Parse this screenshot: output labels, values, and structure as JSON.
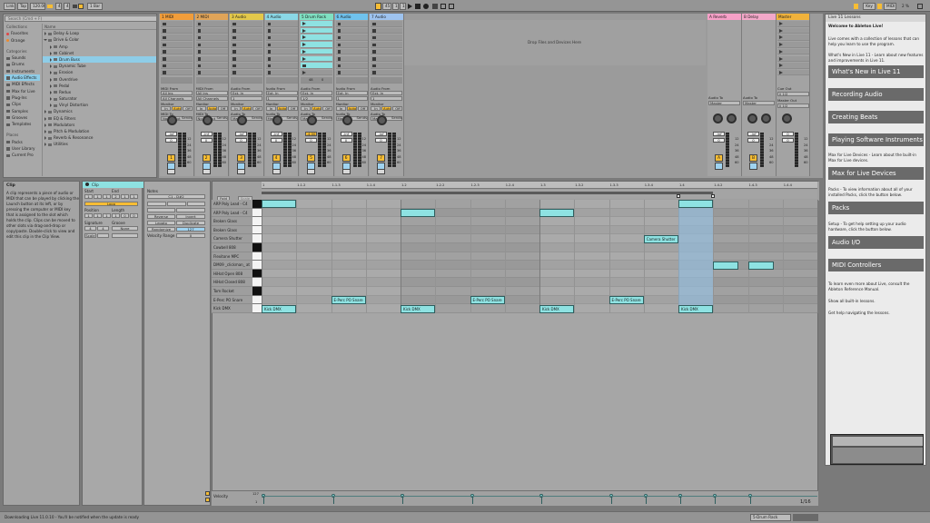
{
  "transport": {
    "link": "Link",
    "tap": "Tap",
    "tempo": "120.00",
    "sig_num": "4",
    "sig_den": "4",
    "quant": "1 Bar",
    "pos_bar": "45",
    "pos_beat": "1",
    "pos_six": "1",
    "key": "Key",
    "midi": "MIDI",
    "cpu": "2 %"
  },
  "browser": {
    "search_placeholder": "Search (Cmd + F)",
    "collections_head": "Collections",
    "collections": [
      {
        "label": "Favorites",
        "color": "#e04444"
      },
      {
        "label": "Orange",
        "color": "#ef8a2b"
      }
    ],
    "categories_head": "Categories",
    "categories": [
      "Sounds",
      "Drums",
      "Instruments",
      "Audio Effects",
      "MIDI Effects",
      "Max for Live",
      "Plug-Ins",
      "Clips",
      "Samples",
      "Grooves",
      "Templates"
    ],
    "selected_category": "Audio Effects",
    "places_head": "Places",
    "places": [
      "Packs",
      "User Library",
      "Current Pro"
    ],
    "name_head": "Name",
    "items": [
      {
        "label": "Delay & Loop",
        "depth": 0,
        "kind": "folder"
      },
      {
        "label": "Drive & Color",
        "depth": 0,
        "kind": "folder-open"
      },
      {
        "label": "Amp",
        "depth": 1,
        "kind": "folder"
      },
      {
        "label": "Cabinet",
        "depth": 1,
        "kind": "folder"
      },
      {
        "label": "Drum Buss",
        "depth": 1,
        "kind": "folder",
        "selected": true
      },
      {
        "label": "Dynamic Tube",
        "depth": 1,
        "kind": "folder"
      },
      {
        "label": "Erosion",
        "depth": 1,
        "kind": "folder"
      },
      {
        "label": "Overdrive",
        "depth": 1,
        "kind": "folder"
      },
      {
        "label": "Pedal",
        "depth": 1,
        "kind": "folder"
      },
      {
        "label": "Redux",
        "depth": 1,
        "kind": "folder"
      },
      {
        "label": "Saturator",
        "depth": 1,
        "kind": "folder"
      },
      {
        "label": "Vinyl Distortion",
        "depth": 1,
        "kind": "folder"
      },
      {
        "label": "Dynamics",
        "depth": 0,
        "kind": "folder"
      },
      {
        "label": "EQ & Filters",
        "depth": 0,
        "kind": "folder"
      },
      {
        "label": "Modulators",
        "depth": 0,
        "kind": "folder"
      },
      {
        "label": "Pitch & Modulation",
        "depth": 0,
        "kind": "folder"
      },
      {
        "label": "Reverb & Resonance",
        "depth": 0,
        "kind": "folder"
      },
      {
        "label": "Utilities",
        "depth": 0,
        "kind": "folder"
      }
    ]
  },
  "tracks": [
    {
      "name": "1 MIDI",
      "color": "#f19d3a",
      "num": "1",
      "kind": "midi"
    },
    {
      "name": "2 MIDI",
      "color": "#e0a458",
      "num": "2",
      "kind": "midi"
    },
    {
      "name": "3 Audio",
      "color": "#e3c84a",
      "num": "3",
      "kind": "audio"
    },
    {
      "name": "4 Audio",
      "color": "#8ad8e6",
      "num": "4",
      "kind": "audio"
    },
    {
      "name": "5 Drum Rack",
      "color": "#7fe0c2",
      "num": "5",
      "kind": "drum"
    },
    {
      "name": "6 Audio",
      "color": "#6fc2ed",
      "num": "6",
      "kind": "audio"
    },
    {
      "name": "7 Audio",
      "color": "#9ec3ef",
      "num": "7",
      "kind": "audio"
    }
  ],
  "returns": [
    {
      "name": "A Reverb",
      "color": "#f6a0c7",
      "letter": "A"
    },
    {
      "name": "B Delay",
      "color": "#f3a8c9",
      "letter": "B"
    }
  ],
  "master": {
    "name": "Master",
    "color": "#f0b23b"
  },
  "session": {
    "drop_hint": "Drop Files and Devices Here",
    "midi_from": "MIDI From",
    "audio_from": "Audio From",
    "all_ins": "All Ins",
    "all_channels": "All Channels",
    "ext_in": "Ext. In",
    "ch_1": "1",
    "ch_12": "1/2",
    "monitor": "Monitor",
    "in": "In",
    "auto": "Auto",
    "off": "Off",
    "midi_to": "MIDI To",
    "audio_to": "Audio To",
    "no_output": "No Output",
    "master_out": "Master",
    "sends": "Sends",
    "cue_out": "Cue Out",
    "master_out_label": "Master Out",
    "cue_val": "ii 1/2",
    "vol_inf": "-inf",
    "vol_0": "0",
    "vol_drum": "-4.00",
    "db_scale": [
      "12",
      "24",
      "36",
      "48",
      "60"
    ],
    "drum_slot_num": "48",
    "drum_slot_val": "0",
    "letter_a": "A",
    "letter_b": "B"
  },
  "clip": {
    "header": "Clip",
    "info_title": "Clip",
    "info_text": "A clip represents a piece of audio or MIDI that can be played by clicking the Launch button at its left, or by pressing the computer or MIDI key that is assigned to the slot which holds the clip. Clips can be moved to other slots via drag-and-drop or copy/paste. Double-click to view and edit this clip in the Clip View.",
    "title": "Clip",
    "start_lbl": "Start",
    "end_lbl": "End",
    "start": [
      "1",
      "1",
      "1"
    ],
    "end": [
      "2",
      "1",
      "1"
    ],
    "loop": "Loop",
    "position_lbl": "Position",
    "length_lbl": "Length",
    "position": [
      "1",
      "1",
      "1"
    ],
    "length": [
      "1",
      "0",
      "0"
    ],
    "signature_lbl": "Signature",
    "groove_lbl": "Groove",
    "sig_num": "4",
    "sig_den": "4",
    "groove": "None",
    "scale": "Scale",
    "notes_lbl": "Notes",
    "note_range": "C1 - D#2",
    "fold": "Fold",
    "scale_btn": "Scale",
    "btns": [
      "Reverse",
      "Invert",
      "Legato",
      "Duplicate",
      "Randomize",
      "127",
      "Velocity Range",
      "0"
    ]
  },
  "piano": {
    "timeline": [
      "1",
      "1.1.2",
      "1.1.3",
      "1.1.4",
      "1.2",
      "1.2.2",
      "1.2.3",
      "1.2.4",
      "1.3",
      "1.3.2",
      "1.3.3",
      "1.3.4",
      "1.4",
      "1.4.2",
      "1.4.3",
      "1.4.4"
    ],
    "lanes": [
      "ARP Poly Lead - C4",
      "ARP Poly Lead - C4",
      "Broken Glass",
      "Broken Glass",
      "Camera Shutter",
      "Cowbell 808",
      "Flexitone MPC",
      "DM09 _clickman_ at",
      "HiHat Open 808",
      "HiHat Closed 808",
      "Tom Rocket",
      "E-Perc PO Snare",
      "Kick DMX"
    ],
    "notes": [
      {
        "lane": 0,
        "start": 0.0,
        "len": 0.0625,
        "label": ""
      },
      {
        "lane": 1,
        "start": 0.25,
        "len": 0.0625,
        "label": ""
      },
      {
        "lane": 1,
        "start": 0.5,
        "len": 0.0625,
        "label": ""
      },
      {
        "lane": 0,
        "start": 0.75,
        "len": 0.0625,
        "label": ""
      },
      {
        "lane": 4,
        "start": 0.6875,
        "len": 0.0625,
        "label": "Camera Shutter"
      },
      {
        "lane": 7,
        "start": 0.8125,
        "len": 0.046,
        "label": ""
      },
      {
        "lane": 7,
        "start": 0.875,
        "len": 0.046,
        "label": ""
      },
      {
        "lane": 11,
        "start": 0.125,
        "len": 0.0625,
        "label": "E-Perc PO Snare"
      },
      {
        "lane": 11,
        "start": 0.375,
        "len": 0.0625,
        "label": "E-Perc PO Snare"
      },
      {
        "lane": 11,
        "start": 0.625,
        "len": 0.0625,
        "label": "E-Perc PO Snare"
      },
      {
        "lane": 12,
        "start": 0.0,
        "len": 0.0625,
        "label": "Kick DMX"
      },
      {
        "lane": 12,
        "start": 0.25,
        "len": 0.0625,
        "label": "Kick DMX"
      },
      {
        "lane": 12,
        "start": 0.5,
        "len": 0.0625,
        "label": "Kick DMX"
      },
      {
        "lane": 12,
        "start": 0.75,
        "len": 0.0625,
        "label": "Kick DMX"
      }
    ],
    "loop_highlight": {
      "start": 0.75,
      "len": 0.0625
    },
    "velocity_lbl": "Velocity",
    "vel_max": "127",
    "vel_min": "1",
    "zoom": "1/16"
  },
  "help": {
    "title": "Live 11 Lessons",
    "welcome": "Welcome to Ableton Live!",
    "intro": "Live comes with a collection of lessons that can help you learn to use the program.",
    "whats_new_text": "What's New in Live 11 - Learn about new features and improvements in Live 11.",
    "lessons": [
      "What's New in Live 11",
      "Recording Audio",
      "Creating Beats",
      "Playing Software Instruments",
      "Max for Live Devices",
      "Packs",
      "Audio I/O",
      "MIDI Controllers"
    ],
    "m4l_text": "Max for Live Devices - Learn about the built-in Max for Live devices.",
    "packs_text": "Packs - To view information about all of your installed Packs, click the button below.",
    "setup_text": "Setup - To get help setting up your audio hardware, click the button below.",
    "manual_text": "To learn even more about Live, consult the Ableton Reference Manual.",
    "show_all": "Show all built-in lessons.",
    "navigating": "Get help navigating the lessons."
  },
  "status": {
    "message": "Downloading Live 11.0.10 - You'll be notified when the update is ready",
    "track_sel": "5-Drum Rack"
  }
}
